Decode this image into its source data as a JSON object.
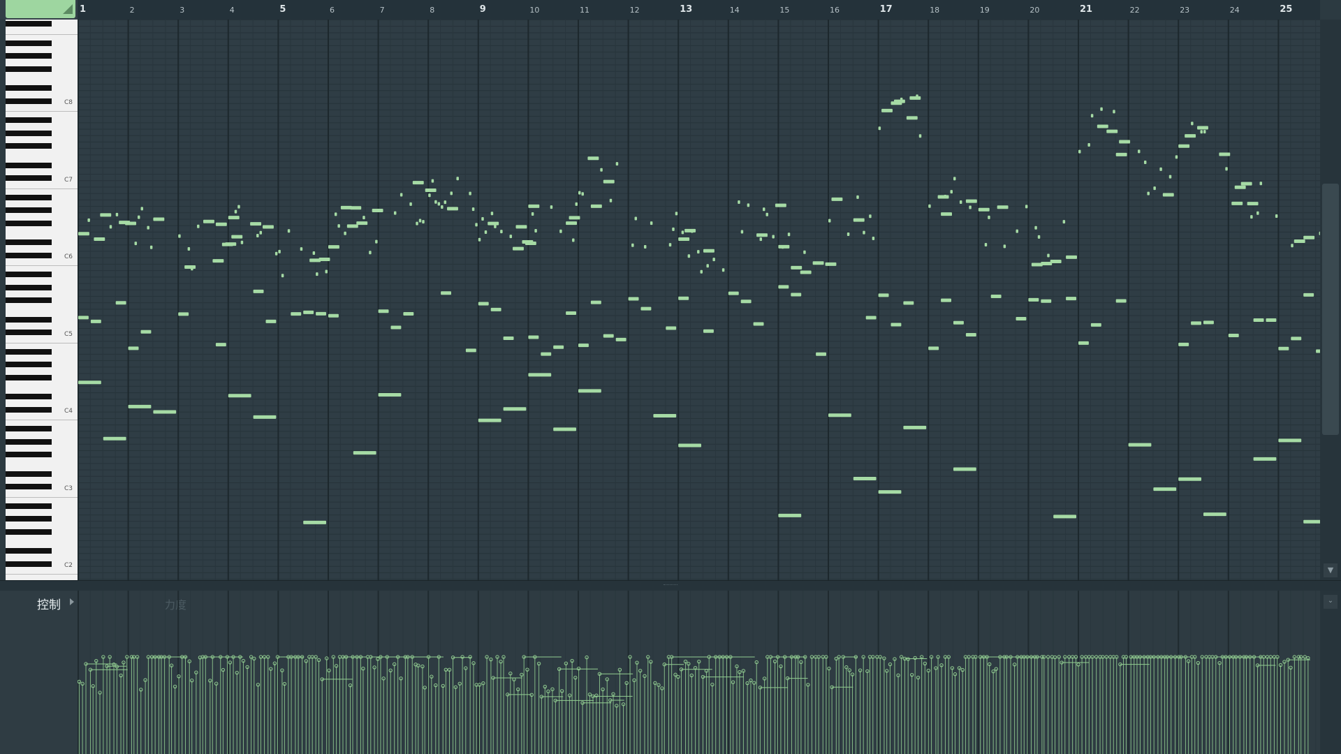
{
  "ruler": {
    "bars": [
      "1",
      "2",
      "3",
      "4",
      "5",
      "6",
      "7",
      "8",
      "9",
      "10",
      "11",
      "12",
      "13",
      "14",
      "15",
      "16",
      "17",
      "18",
      "19",
      "20",
      "21",
      "22",
      "23",
      "24",
      "25"
    ]
  },
  "keyboard": {
    "octave_labels": [
      "C8",
      "C7",
      "C6",
      "C5",
      "C4",
      "C3",
      "C2"
    ]
  },
  "control": {
    "label": "控制",
    "target": "力度"
  },
  "colors": {
    "note": "#a6dba5",
    "velocity": "#93cf92",
    "background": "#2f3d45",
    "ruler": "#24323a"
  },
  "icons": {
    "scroll_down": "chevron-down-icon",
    "panel_menu": "chevron-down-icon",
    "control_menu": "chevron-right-icon"
  }
}
